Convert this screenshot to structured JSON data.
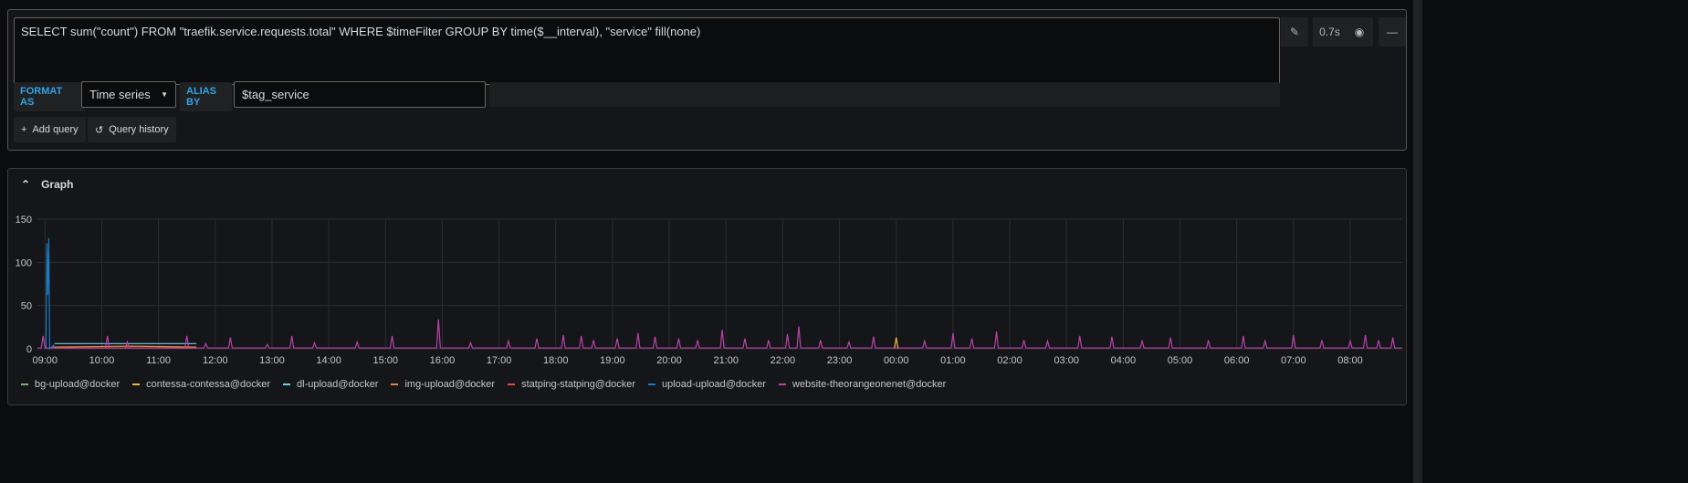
{
  "query": {
    "text": "SELECT sum(\"count\") FROM \"traefik.service.requests.total\" WHERE $timeFilter GROUP BY time($__interval), \"service\" fill(none)",
    "format_label": "FORMAT AS",
    "format_value": "Time series",
    "alias_label": "ALIAS BY",
    "alias_value": "$tag_service",
    "time_badge": "0.7s",
    "add_query": "Add query",
    "query_history": "Query history"
  },
  "graph": {
    "title": "Graph"
  },
  "chart_data": {
    "type": "line",
    "ylim": [
      0,
      150
    ],
    "yticks": [
      "0",
      "50",
      "100",
      "150"
    ],
    "xticks": [
      "09:00",
      "10:00",
      "11:00",
      "12:00",
      "13:00",
      "14:00",
      "15:00",
      "16:00",
      "17:00",
      "18:00",
      "19:00",
      "20:00",
      "21:00",
      "22:00",
      "23:00",
      "00:00",
      "01:00",
      "02:00",
      "03:00",
      "04:00",
      "05:00",
      "06:00",
      "07:00",
      "08:00"
    ],
    "xrange": [
      "08:52",
      "08:55"
    ],
    "grid": true,
    "legend_placement": "bottom",
    "series": [
      {
        "name": "bg-upload@docker",
        "color": "#7eb26d",
        "points": [
          [
            "09:10",
            1
          ],
          [
            "11:40",
            1
          ]
        ]
      },
      {
        "name": "contessa-contessa@docker",
        "color": "#eab839",
        "points": [
          [
            "23:58",
            0
          ],
          [
            "00:00",
            13
          ],
          [
            "00:02",
            0
          ]
        ]
      },
      {
        "name": "dl-upload@docker",
        "color": "#6ed0e0",
        "points": [
          [
            "09:10",
            6
          ],
          [
            "11:40",
            6
          ]
        ]
      },
      {
        "name": "img-upload@docker",
        "color": "#ef843c",
        "points": [
          [
            "09:08",
            2
          ],
          [
            "10:30",
            3
          ],
          [
            "11:40",
            2
          ]
        ]
      },
      {
        "name": "statping-statping@docker",
        "color": "#e24d42",
        "points": [
          [
            "09:05",
            1
          ],
          [
            "11:40",
            1
          ]
        ]
      },
      {
        "name": "upload-upload@docker",
        "color": "#1f78c1",
        "points": [
          [
            "09:01",
            0
          ],
          [
            "09:02",
            122
          ],
          [
            "09:03",
            62
          ],
          [
            "09:04",
            128
          ],
          [
            "09:05",
            0
          ],
          [
            "09:09",
            4
          ],
          [
            "09:10",
            0
          ]
        ]
      },
      {
        "name": "website-theorangeonenet@docker",
        "color": "#ba43a9",
        "points": [
          [
            "08:58",
            15
          ],
          [
            "10:06",
            15
          ],
          [
            "10:27",
            8
          ],
          [
            "11:30",
            15
          ],
          [
            "11:50",
            6
          ],
          [
            "12:16",
            13
          ],
          [
            "12:55",
            5
          ],
          [
            "13:21",
            15
          ],
          [
            "13:45",
            7
          ],
          [
            "14:30",
            8
          ],
          [
            "15:07",
            15
          ],
          [
            "15:56",
            34
          ],
          [
            "16:30",
            7
          ],
          [
            "17:10",
            9
          ],
          [
            "17:40",
            12
          ],
          [
            "18:08",
            16
          ],
          [
            "18:27",
            15
          ],
          [
            "18:40",
            10
          ],
          [
            "19:05",
            12
          ],
          [
            "19:27",
            18
          ],
          [
            "19:45",
            14
          ],
          [
            "20:10",
            12
          ],
          [
            "20:30",
            10
          ],
          [
            "20:56",
            22
          ],
          [
            "21:20",
            12
          ],
          [
            "21:45",
            10
          ],
          [
            "22:05",
            17
          ],
          [
            "22:17",
            26
          ],
          [
            "22:40",
            10
          ],
          [
            "23:10",
            8
          ],
          [
            "23:36",
            14
          ],
          [
            "00:30",
            9
          ],
          [
            "01:00",
            18
          ],
          [
            "01:20",
            12
          ],
          [
            "01:46",
            20
          ],
          [
            "02:15",
            10
          ],
          [
            "02:40",
            9
          ],
          [
            "03:14",
            15
          ],
          [
            "03:48",
            14
          ],
          [
            "04:20",
            9
          ],
          [
            "04:50",
            13
          ],
          [
            "05:30",
            10
          ],
          [
            "06:07",
            15
          ],
          [
            "06:30",
            9
          ],
          [
            "07:00",
            16
          ],
          [
            "07:30",
            10
          ],
          [
            "08:00",
            9
          ],
          [
            "08:16",
            16
          ],
          [
            "08:30",
            10
          ],
          [
            "08:45",
            13
          ]
        ]
      }
    ]
  }
}
